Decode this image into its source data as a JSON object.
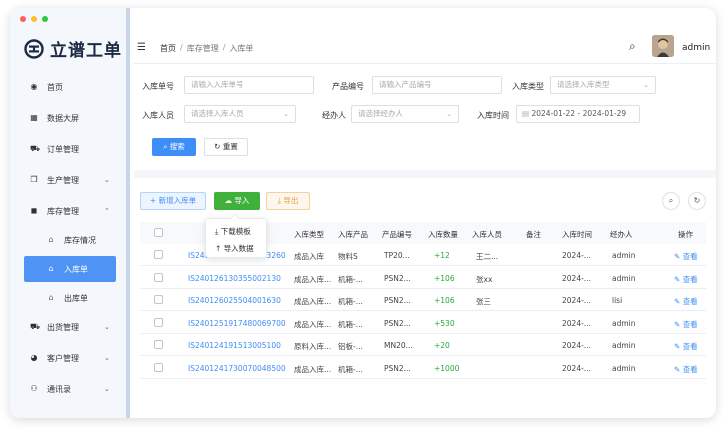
{
  "window": {
    "traffic_colors": [
      "#ff5f57",
      "#febc2e",
      "#28c840"
    ]
  },
  "brand": {
    "name": "立谱工单",
    "color": "#1d2a44",
    "accent": "#3e8ef7"
  },
  "sidebar": {
    "items": [
      {
        "label": "首页",
        "icon": "dashboard-icon",
        "glyph": "◉"
      },
      {
        "label": "数据大屏",
        "icon": "grid-icon",
        "glyph": "▦"
      },
      {
        "label": "订单管理",
        "icon": "cart-icon",
        "glyph": "⛟"
      },
      {
        "label": "生产管理",
        "icon": "copy-icon",
        "glyph": "❐",
        "arrow": "⌄"
      },
      {
        "label": "库存管理",
        "icon": "box-icon",
        "glyph": "◼",
        "arrow": "⌃"
      },
      {
        "label": "库存情况",
        "icon": "home-icon",
        "glyph": "⌂",
        "sub": true
      },
      {
        "label": "入库单",
        "icon": "home-icon",
        "glyph": "⌂",
        "sub": true,
        "active": true
      },
      {
        "label": "出库单",
        "icon": "home-icon",
        "glyph": "⌂",
        "sub": true
      },
      {
        "label": "出货管理",
        "icon": "truck-icon",
        "glyph": "⛟",
        "arrow": "⌄"
      },
      {
        "label": "客户管理",
        "icon": "users-icon",
        "glyph": "◕",
        "arrow": "⌄"
      },
      {
        "label": "通讯录",
        "icon": "org-icon",
        "glyph": "⚇",
        "arrow": "⌄"
      }
    ]
  },
  "header": {
    "breadcrumb": [
      "首页",
      "库存管理",
      "入库单"
    ],
    "sep": "/",
    "hamburger_glyph": "☰",
    "search_glyph": "⌕",
    "username": "admin"
  },
  "filters": {
    "order_no_label": "入库单号",
    "order_no_placeholder": "请输入入库单号",
    "product_no_label": "产品编号",
    "product_no_placeholder": "请输入产品编号",
    "type_label": "入库类型",
    "type_placeholder": "请选择入库类型",
    "person_label": "入库人员",
    "person_placeholder": "请选择入库人员",
    "handler_label": "经办人",
    "handler_placeholder": "请选择经办人",
    "time_label": "入库时间",
    "date_start": "2024-01-22",
    "date_sep": "-",
    "date_end": "2024-01-29",
    "caret": "⌄",
    "calendar_glyph": "▤",
    "search_label": "搜索",
    "search_glyph": "⌕",
    "reset_label": "重置",
    "reset_glyph": "↻"
  },
  "toolbar": {
    "add_label": "新增入库单",
    "add_glyph": "+",
    "import_label": "导入",
    "import_glyph": "☁",
    "export_label": "导出",
    "export_glyph": "⤓",
    "search_glyph": "⌕",
    "refresh_glyph": "↻"
  },
  "import_menu": {
    "items": [
      {
        "glyph": "⤓",
        "label": "下载模板"
      },
      {
        "glyph": "↑",
        "label": "导入数据"
      }
    ]
  },
  "table": {
    "headers": [
      "入库类型",
      "入库产品",
      "产品编号",
      "入库数量",
      "入库人员",
      "备注",
      "入库时间",
      "经办人",
      "操作"
    ],
    "view_label": "查看",
    "view_glyph": "✎",
    "rows": [
      {
        "no": "IS2401291159000003260",
        "type": "成品入库",
        "product": "物料S",
        "code": "TP20...",
        "qty": "+12",
        "person": "王二...",
        "note": "",
        "time": "2024-...",
        "handler": "admin"
      },
      {
        "no": "IS240126130355002130",
        "type": "成品入库...",
        "product": "机箱-...",
        "code": "PSN2...",
        "qty": "+106",
        "person": "张xx",
        "note": "",
        "time": "2024-...",
        "handler": "admin"
      },
      {
        "no": "IS240126025504001630",
        "type": "成品入库...",
        "product": "机箱-...",
        "code": "PSN2...",
        "qty": "+106",
        "person": "张三",
        "note": "",
        "time": "2024-...",
        "handler": "lisi"
      },
      {
        "no": "IS2401251917480069700",
        "type": "成品入库...",
        "product": "机箱-...",
        "code": "PSN2...",
        "qty": "+530",
        "person": "",
        "note": "",
        "time": "2024-...",
        "handler": "admin"
      },
      {
        "no": "IS240124191513005100",
        "type": "原料入库...",
        "product": "铝板-...",
        "code": "MN20...",
        "qty": "+20",
        "person": "",
        "note": "",
        "time": "2024-...",
        "handler": "admin"
      },
      {
        "no": "IS2401241730070048500",
        "type": "成品入库...",
        "product": "机箱-...",
        "code": "PSN2...",
        "qty": "+1000",
        "person": "",
        "note": "",
        "time": "2024-...",
        "handler": "admin"
      }
    ]
  }
}
